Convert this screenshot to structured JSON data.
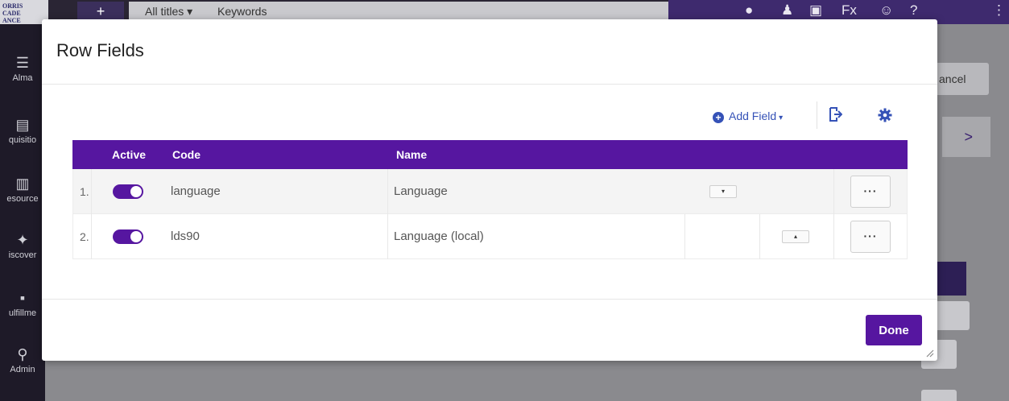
{
  "background": {
    "search_scope": "All titles ▾",
    "search_type": "Keywords",
    "nav": [
      {
        "label": "Alma",
        "glyph": "☰"
      },
      {
        "label": "quisitio",
        "glyph": "▤"
      },
      {
        "label": "esource",
        "glyph": "▥"
      },
      {
        "label": "iscover",
        "glyph": "✦"
      },
      {
        "label": "ulfillme",
        "glyph": "▪"
      },
      {
        "label": "Admin",
        "glyph": "⚲"
      }
    ],
    "cancel_label": "ancel",
    "arrow_label": ">",
    "dots_label": "..."
  },
  "modal": {
    "title": "Row Fields",
    "toolbar": {
      "add_field_label": "Add Field",
      "add_glyph": "+",
      "caret": "▾"
    },
    "grid": {
      "columns": {
        "active": "Active",
        "code": "Code",
        "name": "Name"
      },
      "rows": [
        {
          "num": "1.",
          "code": "language",
          "name": "Language",
          "active": true,
          "move": "▾",
          "actions": "···"
        },
        {
          "num": "2.",
          "code": "lds90",
          "name": "Language (local)",
          "active": true,
          "move": "▴",
          "actions": "···"
        }
      ]
    },
    "done_label": "Done"
  },
  "colors": {
    "accent": "#5616a0",
    "link": "#3552b7"
  }
}
